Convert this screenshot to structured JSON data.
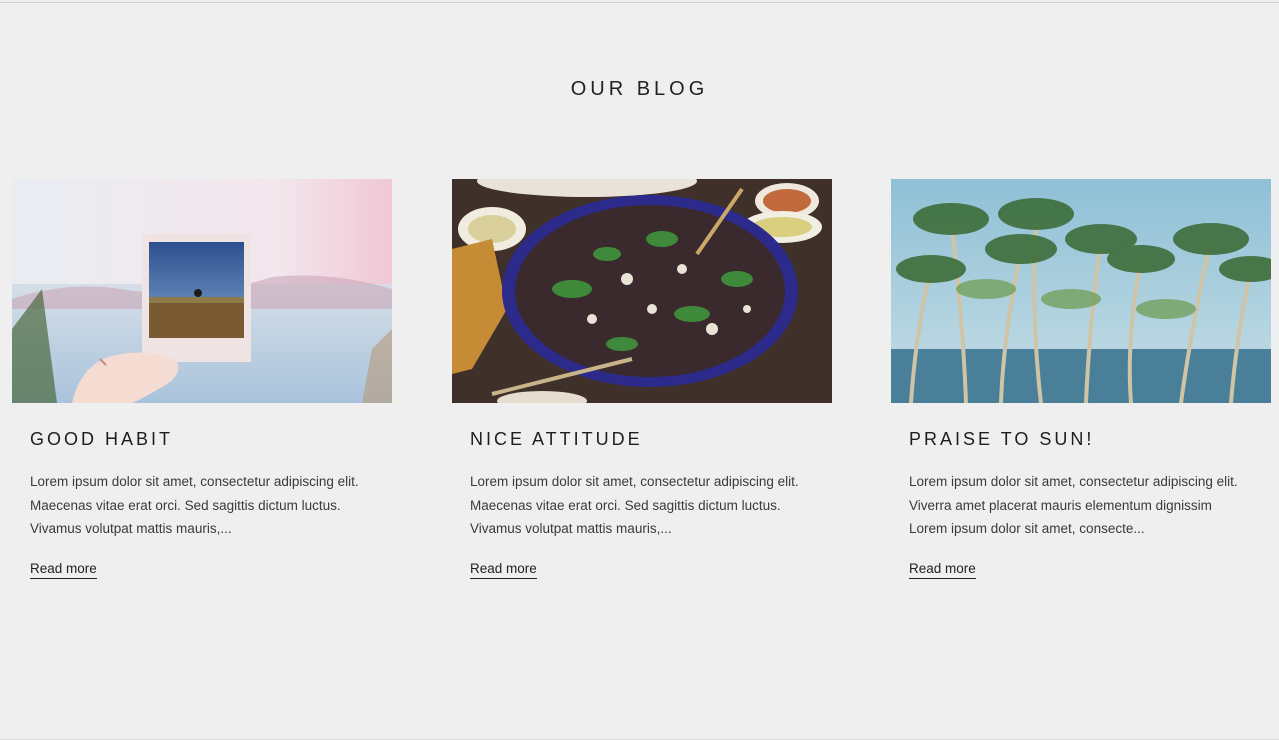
{
  "blog": {
    "heading": "OUR BLOG",
    "posts": [
      {
        "title": "GOOD HABIT",
        "excerpt_lines": [
          "Lorem ipsum dolor sit amet, consectetur adipiscing elit.",
          "Maecenas vitae erat orci. Sed sagittis dictum luctus.",
          "Vivamus volutpat mattis mauris,..."
        ],
        "link_label": "Read more"
      },
      {
        "title": "NICE ATTITUDE",
        "excerpt_lines": [
          "Lorem ipsum dolor sit amet, consectetur adipiscing elit.",
          "Maecenas vitae erat orci. Sed sagittis dictum luctus.",
          "Vivamus volutpat mattis mauris,..."
        ],
        "link_label": "Read more"
      },
      {
        "title": "PRAISE TO SUN!",
        "excerpt_lines": [
          "Lorem ipsum dolor sit amet, consectetur adipiscing elit.",
          "Viverra amet placerat mauris elementum dignissim",
          "Lorem ipsum dolor sit amet, consecte..."
        ],
        "link_label": "Read more"
      }
    ]
  }
}
